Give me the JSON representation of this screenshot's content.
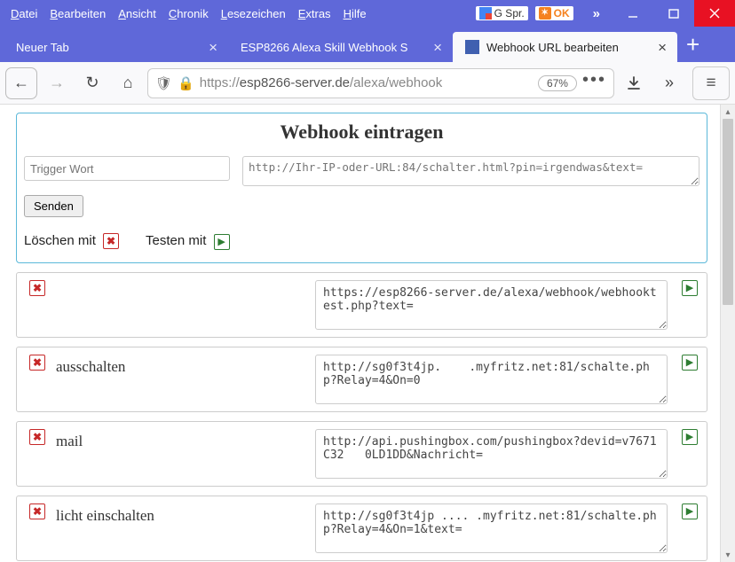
{
  "menu": {
    "datei": "Datei",
    "bearbeiten": "Bearbeiten",
    "ansicht": "Ansicht",
    "chronik": "Chronik",
    "lesezeichen": "Lesezeichen",
    "extras": "Extras",
    "hilfe": "Hilfe"
  },
  "titlebar": {
    "gspr": "G Spr.",
    "ok": "OK"
  },
  "tabs": [
    {
      "title": "Neuer Tab"
    },
    {
      "title": "ESP8266 Alexa Skill Webhook S"
    },
    {
      "title": "Webhook URL bearbeiten"
    }
  ],
  "url": {
    "proto": "https://",
    "host": "esp8266-server.de",
    "path": "/alexa/webhook"
  },
  "zoom": "67%",
  "page": {
    "title": "Webhook eintragen",
    "trigger_placeholder": "Trigger Wort",
    "url_placeholder": "http://Ihr-IP-oder-URL:84/schalter.html?pin=irgendwas&text=",
    "send": "Senden",
    "delete_legend": "Löschen mit",
    "test_legend": "Testen mit"
  },
  "webhooks": [
    {
      "trigger": "",
      "url": "https://esp8266-server.de/alexa/webhook/webhooktest.php?text="
    },
    {
      "trigger": "ausschalten",
      "url": "http://sg0f3t4jp.    .myfritz.net:81/schalte.php?Relay=4&On=0"
    },
    {
      "trigger": "mail",
      "url": "http://api.pushingbox.com/pushingbox?devid=v7671C32   0LD1DD&Nachricht="
    },
    {
      "trigger": "licht einschalten",
      "url": "http://sg0f3t4jp .... .myfritz.net:81/schalte.php?Relay=4&On=1&text="
    }
  ]
}
